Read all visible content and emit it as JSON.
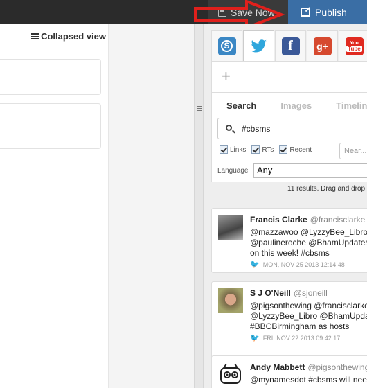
{
  "toolbar": {
    "save_label": "Save Now",
    "publish_label": "Publish"
  },
  "editor": {
    "view_toggle_label": "Collapsed view"
  },
  "social_tabs": [
    {
      "name": "storify",
      "icon": "S"
    },
    {
      "name": "twitter",
      "icon": "twitter-bird"
    },
    {
      "name": "facebook",
      "icon": "f"
    },
    {
      "name": "google-plus",
      "icon": "g+"
    },
    {
      "name": "youtube",
      "icon": "You Tube"
    }
  ],
  "search": {
    "add_label": "+",
    "tabs": [
      "Search",
      "Images",
      "Timeline"
    ],
    "active_tab": "Search",
    "query": "#cbsms",
    "filters": [
      {
        "label": "Links",
        "checked": true
      },
      {
        "label": "RTs",
        "checked": true
      },
      {
        "label": "Recent",
        "checked": true
      }
    ],
    "near_placeholder": "Near...",
    "language_label": "Language",
    "language_value": "Any"
  },
  "results_text": "11 results. Drag and drop",
  "tweets": [
    {
      "name": "Francis Clarke",
      "handle": "@francisclarke",
      "lines": [
        "@mazzawoo @LyzzyBee_Libro",
        "@paulineroche @BhamUpdates",
        "on this week! #cbsms"
      ],
      "timestamp": "MON, NOV 25 2013 12:14:48"
    },
    {
      "name": "S J O'Neill",
      "handle": "@sjoneill",
      "lines": [
        "@pigsonthewing @francisclarke",
        "@LyzzyBee_Libro @BhamUpdates",
        "#BBCBirmingham as hosts"
      ],
      "timestamp": "FRI, NOV 22 2013 09:42:17"
    },
    {
      "name": "Andy Mabbett",
      "handle": "@pigsonthewing",
      "lines": [
        "@mynamesdot #cbsms will need"
      ],
      "timestamp": ""
    }
  ],
  "colors": {
    "topbar": "#2b2b2b",
    "publish": "#3a6ea5",
    "arrow": "#e0201c",
    "twitter": "#55acee"
  }
}
